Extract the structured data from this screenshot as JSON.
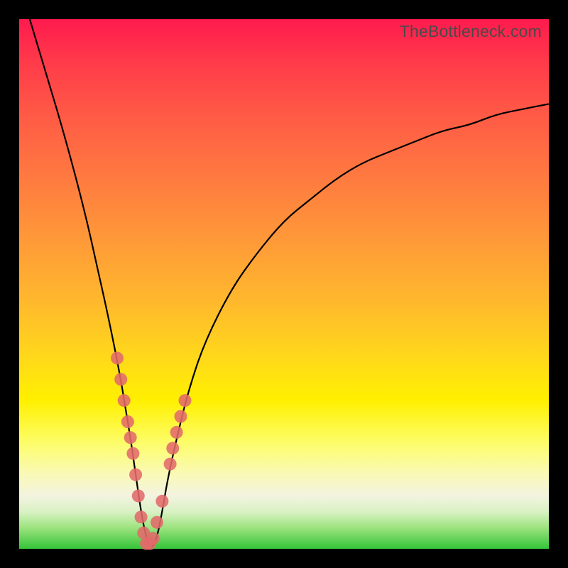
{
  "watermark": "TheBottleneck.com",
  "chart_data": {
    "type": "line",
    "title": "",
    "xlabel": "",
    "ylabel": "",
    "xlim": [
      0,
      100
    ],
    "ylim": [
      0,
      100
    ],
    "grid": false,
    "legend": false,
    "series": [
      {
        "name": "bottleneck-curve",
        "x": [
          2,
          5,
          8,
          11,
          13,
          15,
          17,
          19,
          20,
          21,
          22,
          23,
          24,
          25,
          26,
          27,
          28,
          30,
          32,
          35,
          40,
          45,
          50,
          55,
          60,
          65,
          70,
          75,
          80,
          85,
          90,
          95,
          100
        ],
        "y": [
          100,
          90,
          80,
          69,
          61,
          52,
          43,
          33,
          27,
          21,
          14,
          7,
          2,
          0,
          2,
          7,
          13,
          22,
          30,
          39,
          49,
          56,
          62,
          66,
          70,
          73,
          75,
          77,
          79,
          80,
          82,
          83,
          84
        ]
      }
    ],
    "scatter_points": {
      "name": "sample-points",
      "x": [
        18.5,
        19.2,
        19.8,
        20.5,
        21.0,
        21.5,
        22.0,
        22.5,
        23.0,
        23.5,
        24.0,
        24.7,
        25.3,
        26.0,
        27.0,
        28.5,
        29.0,
        29.7,
        30.5,
        31.3
      ],
      "y": [
        36,
        32,
        28,
        24,
        21,
        18,
        14,
        10,
        6,
        3,
        1,
        1,
        2,
        5,
        9,
        16,
        19,
        22,
        25,
        28
      ]
    },
    "gradient_stops": [
      {
        "pos": 0,
        "color": "#ff1a4e"
      },
      {
        "pos": 30,
        "color": "#ff7a40"
      },
      {
        "pos": 64,
        "color": "#ffd91a"
      },
      {
        "pos": 86,
        "color": "#f9f9b8"
      },
      {
        "pos": 100,
        "color": "#35c43a"
      }
    ]
  }
}
